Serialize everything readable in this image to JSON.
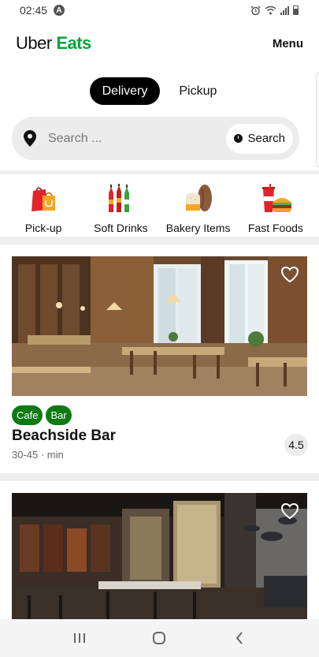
{
  "status_bar": {
    "time": "02:45",
    "notification_icon": "a-icon"
  },
  "header": {
    "logo_word1": "Uber",
    "logo_word2": "Eats",
    "menu_label": "Menu",
    "brand_color": "#06a53a"
  },
  "delivery_toggle": {
    "options": [
      "Delivery",
      "Pickup"
    ],
    "selected": "Delivery"
  },
  "search": {
    "placeholder": "Search ...",
    "button_label": "Search",
    "icon": "location-pin-icon"
  },
  "categories": [
    {
      "label": "Pick-up",
      "icon": "shopping-bags-icon"
    },
    {
      "label": "Soft Drinks",
      "icon": "soft-drink-bottles-icon"
    },
    {
      "label": "Bakery Items",
      "icon": "bread-icon"
    },
    {
      "label": "Fast Foods",
      "icon": "burger-fries-icon"
    }
  ],
  "stores": [
    {
      "name": "Beachside Bar",
      "delivery_time": "30-45 · min",
      "rating": "4.5",
      "tags": [
        "Cafe",
        "Bar"
      ],
      "favorite": false
    },
    {
      "favorite": false
    }
  ],
  "colors": {
    "tag_background": "#0e7a14",
    "search_background": "#ececec"
  }
}
